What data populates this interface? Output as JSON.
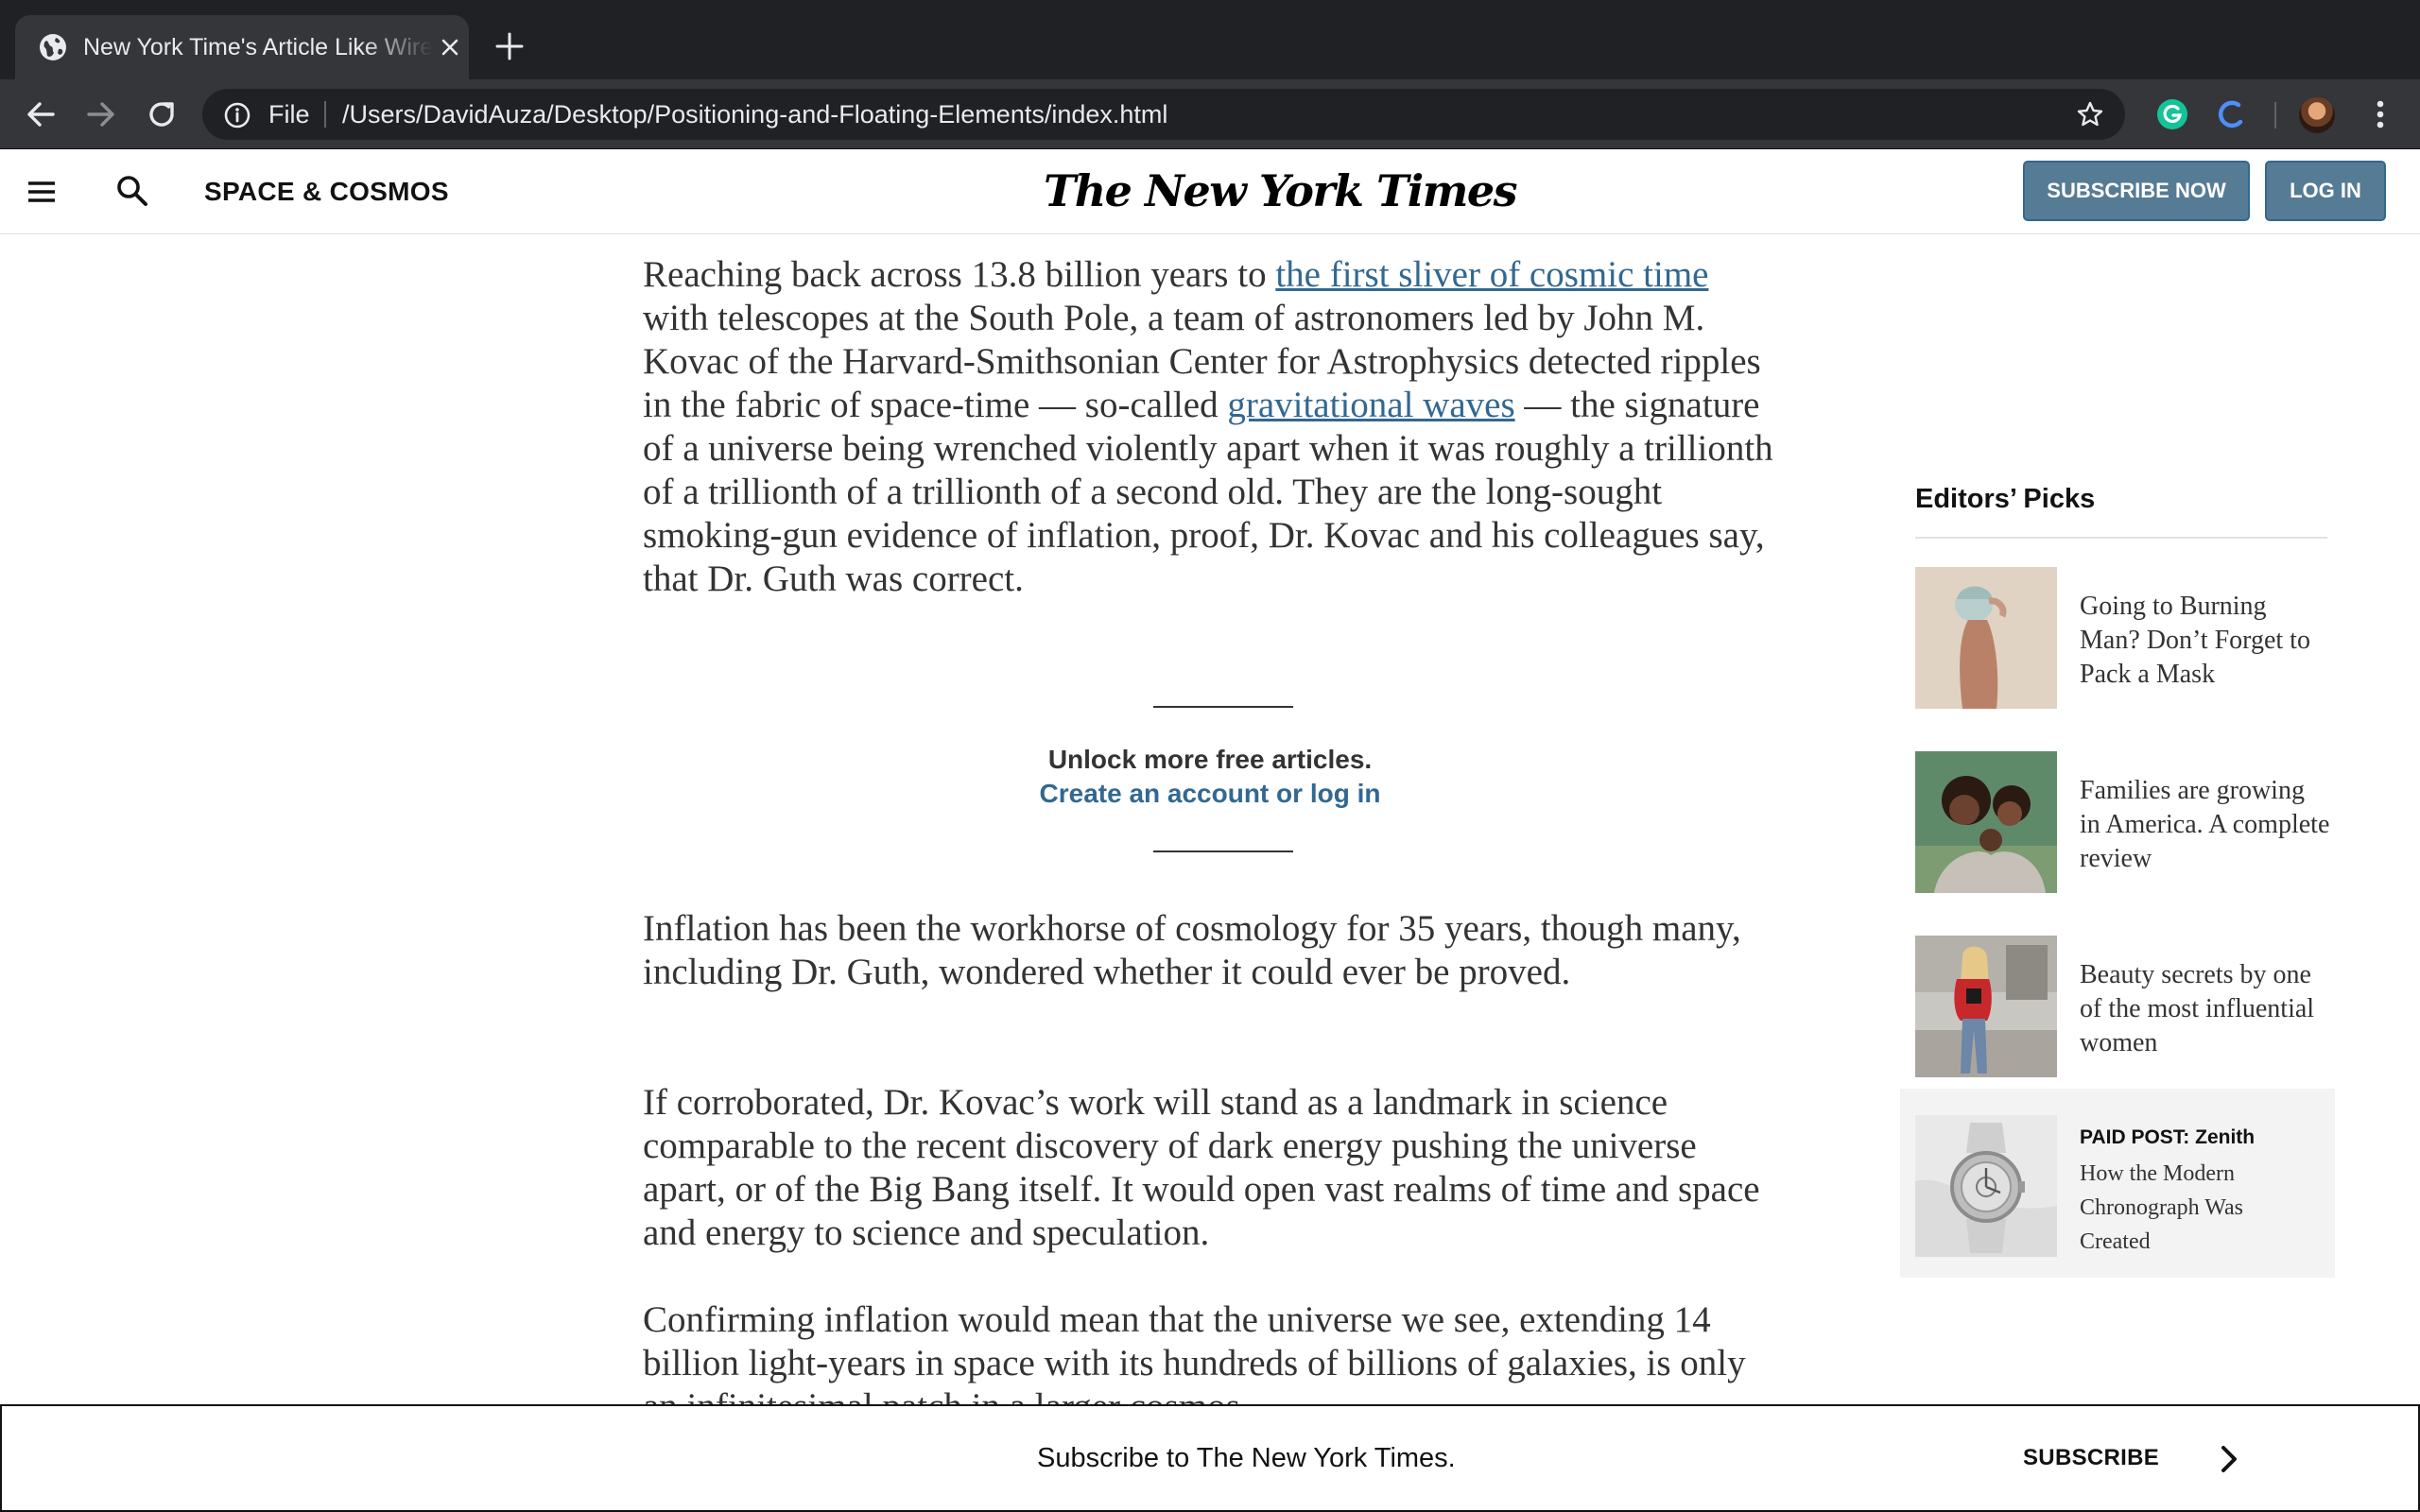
{
  "browser": {
    "tab_title": "New York Time's Article Like Wireframe",
    "address_scheme": "File",
    "address_url": "/Users/DavidAuza/Desktop/Positioning-and-Floating-Elements/index.html"
  },
  "header": {
    "section": "SPACE & COSMOS",
    "masthead": "The New York Times",
    "subscribe_label": "SUBSCRIBE NOW",
    "login_label": "LOG IN"
  },
  "article": {
    "p1": {
      "a": "Reaching back across 13.8 billion years to ",
      "link1": "the first sliver of cosmic time",
      "b": " with telescopes at the South Pole, a team of astronomers led by John M. Kovac of the Harvard-Smithsonian Center for Astrophysics detected ripples in the fabric of space-time — so-called ",
      "link2": "gravitational waves",
      "c": " — the signature of a universe being wrenched violently apart when it was roughly a trillionth of a trillionth of a trillionth of a second old. They are the long-sought smoking-gun evidence of inflation, proof, Dr. Kovac and his colleagues say, that Dr. Guth was correct."
    },
    "unlock_title": "Unlock more free articles.",
    "unlock_link": "Create an account or log in",
    "p2": "Inflation has been the workhorse of cosmology for 35 years, though many, including Dr. Guth, wondered whether it could ever be proved.",
    "p3": "If corroborated, Dr. Kovac’s work will stand as a landmark in science comparable to the recent discovery of dark energy pushing the universe apart, or of the Big Bang itself. It would open vast realms of time and space and energy to science and speculation.",
    "p4": "Confirming inflation would mean that the universe we see, extending 14 billion light-years in space with its hundreds of billions of galaxies, is only an infinitesimal patch in a larger cosmos"
  },
  "sidebar": {
    "heading": "Editors’ Picks",
    "picks": [
      {
        "title": "Going to Burning Man? Don’t Forget to Pack a Mask"
      },
      {
        "title": "Families are growing in America. A complete review"
      },
      {
        "title": "Beauty secrets by one of the most influential women"
      }
    ],
    "paid": {
      "label": "PAID POST: Zenith",
      "title": "How the Modern Chronograph Was Created"
    }
  },
  "subscribe_bar": {
    "text": "Subscribe to The New York Times.",
    "button": "SUBSCRIBE"
  },
  "colors": {
    "link": "#326891",
    "button_bg": "#567b95",
    "chrome_dark": "#202124",
    "chrome_toolbar": "#35363a"
  }
}
